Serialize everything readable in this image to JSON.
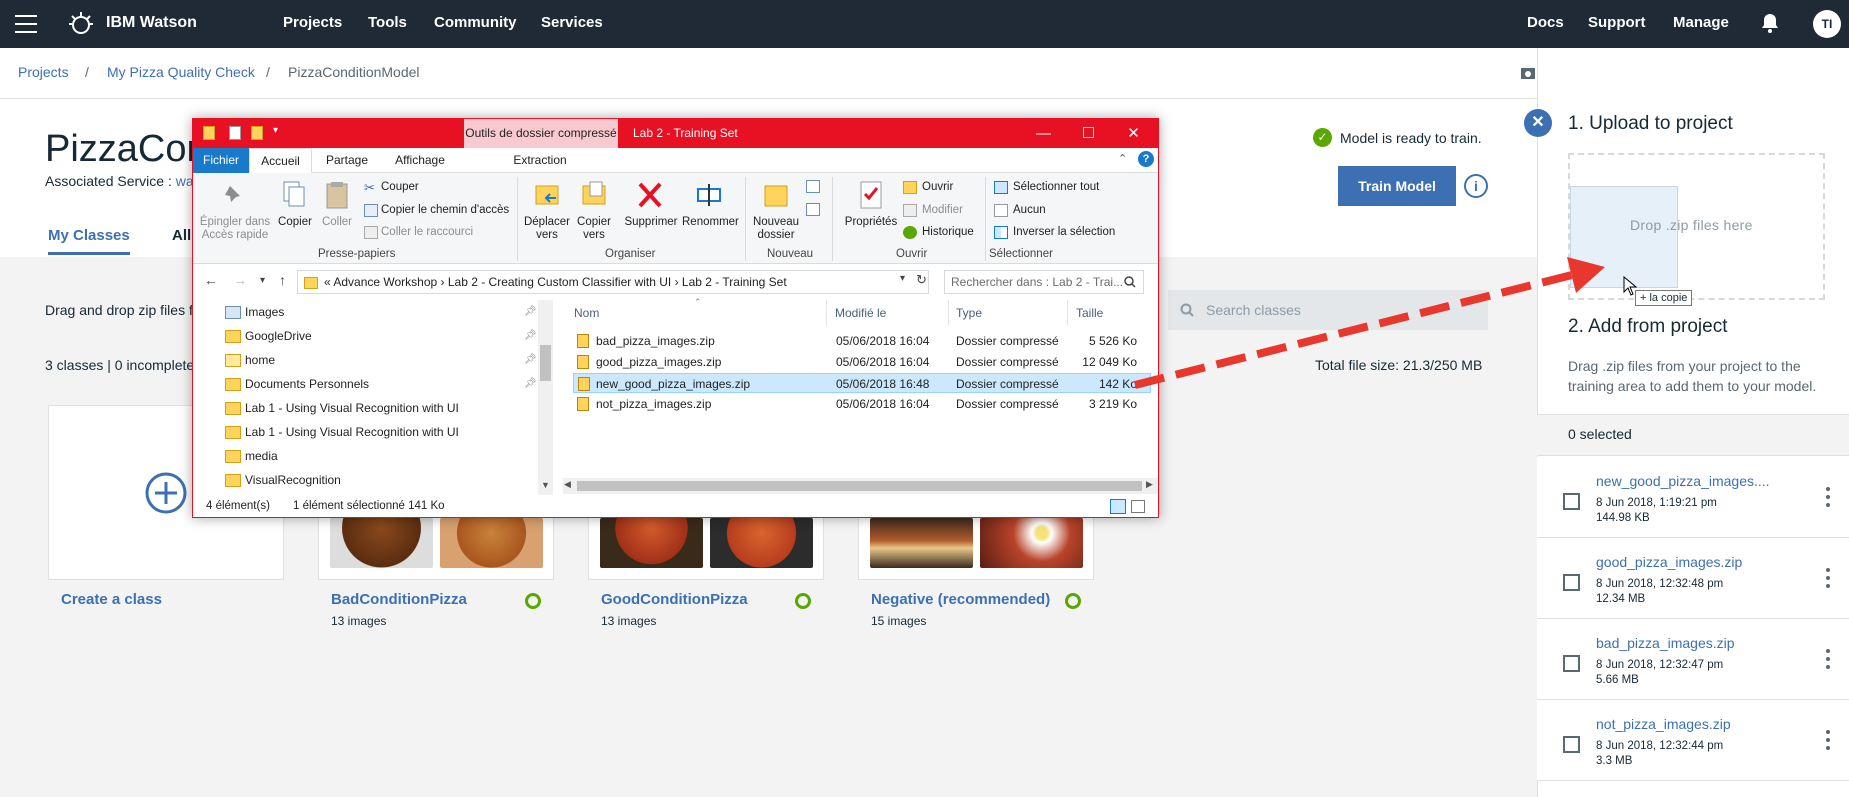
{
  "topnav": {
    "brand": "IBM Watson",
    "links": [
      "Projects",
      "Tools",
      "Community",
      "Services"
    ],
    "right_links": [
      "Docs",
      "Support",
      "Manage"
    ],
    "avatar": "TI"
  },
  "breadcrumb": {
    "items": [
      "Projects",
      "My Pizza Quality Check",
      "PizzaConditionModel"
    ],
    "sep": "/"
  },
  "header": {
    "title": "PizzaCon",
    "associated_prefix": "Associated Service : ",
    "associated_value": "wa",
    "tabs": [
      "My Classes",
      "All"
    ],
    "ready_text": "Model is ready to train.",
    "train_button": "Train Model"
  },
  "content": {
    "drag_text": "Drag and drop zip files f",
    "search_placeholder": "Search classes",
    "counts": "3 classes | 0 incomplete",
    "total_size": "Total file size: 21.3/250 MB",
    "create_card": "Create a class",
    "classes": [
      {
        "name": "BadConditionPizza",
        "images": "13 images"
      },
      {
        "name": "GoodConditionPizza",
        "images": "13 images"
      },
      {
        "name": "Negative (recommended)",
        "images": "15 images"
      }
    ]
  },
  "panel": {
    "upload_title": "1. Upload to project",
    "drop_text": "Drop .zip files here",
    "copy_badge": "+ la copie",
    "add_title": "2. Add from project",
    "add_desc": "Drag .zip files from your project to the training area to add them to your model.",
    "selected": "0 selected",
    "files": [
      {
        "name": "new_good_pizza_images....",
        "date": "8 Jun 2018, 1:19:21 pm",
        "size": "144.98 KB"
      },
      {
        "name": "good_pizza_images.zip",
        "date": "8 Jun 2018, 12:32:48 pm",
        "size": "12.34 MB"
      },
      {
        "name": "bad_pizza_images.zip",
        "date": "8 Jun 2018, 12:32:47 pm",
        "size": "5.66 MB"
      },
      {
        "name": "not_pizza_images.zip",
        "date": "8 Jun 2018, 12:32:44 pm",
        "size": "3.3 MB"
      }
    ]
  },
  "explorer": {
    "context_tab": "Outils de dossier compressé",
    "title": "Lab 2 - Training Set",
    "tabs": [
      "Fichier",
      "Accueil",
      "Partage",
      "Affichage",
      "Extraction"
    ],
    "ribbon": {
      "pin": "Épingler dans Accès rapide",
      "copy": "Copier",
      "paste": "Coller",
      "cut": "Couper",
      "copy_path": "Copier le chemin d'accès",
      "paste_shortcut": "Coller le raccourci",
      "group_clipboard": "Presse-papiers",
      "move_to": "Déplacer vers",
      "copy_to": "Copier vers",
      "delete": "Supprimer",
      "rename": "Renommer",
      "group_organize": "Organiser",
      "new_folder": "Nouveau dossier",
      "group_new": "Nouveau",
      "properties": "Propriétés",
      "open": "Ouvrir",
      "modify": "Modifier",
      "history": "Historique",
      "group_open": "Ouvrir",
      "select_all": "Sélectionner tout",
      "select_none": "Aucun",
      "invert": "Inverser la sélection",
      "group_select": "Sélectionner"
    },
    "address": "«   Advance Workshop  ›  Lab 2 - Creating Custom Classifier with UI  ›  Lab 2 - Training Set",
    "search_placeholder": "Rechercher dans : Lab 2 - Trai...",
    "tree": [
      "Images",
      "GoogleDrive",
      "home",
      "Documents Personnels",
      "Lab 1 - Using Visual Recognition with UI",
      "Lab 1 - Using Visual Recognition with UI",
      "media",
      "VisualRecognition"
    ],
    "columns": [
      "Nom",
      "Modifié le",
      "Type",
      "Taille"
    ],
    "files": [
      {
        "name": "bad_pizza_images.zip",
        "modified": "05/06/2018 16:04",
        "type": "Dossier compressé",
        "size": "5 526 Ko"
      },
      {
        "name": "good_pizza_images.zip",
        "modified": "05/06/2018 16:04",
        "type": "Dossier compressé",
        "size": "12 049 Ko"
      },
      {
        "name": "new_good_pizza_images.zip",
        "modified": "05/06/2018 16:48",
        "type": "Dossier compressé",
        "size": "142 Ko"
      },
      {
        "name": "not_pizza_images.zip",
        "modified": "05/06/2018 16:04",
        "type": "Dossier compressé",
        "size": "3 219 Ko"
      }
    ],
    "status_count": "4 élément(s)",
    "status_selection": "1 élément sélectionné  141 Ko"
  },
  "colors": {
    "nav": "#1f2a36",
    "accent": "#3d70b2",
    "success": "#5aa700",
    "explorer_red": "#e81123",
    "arrow": "#e8372d"
  }
}
